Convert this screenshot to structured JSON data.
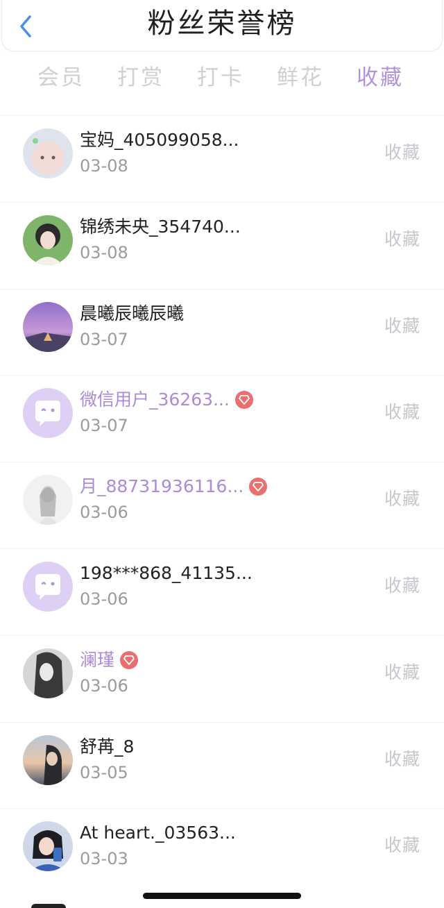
{
  "header": {
    "title": "粉丝荣誉榜",
    "back_icon": "chevron-left-icon",
    "accent_color": "#4a90e2"
  },
  "tabs": [
    {
      "label": "会员",
      "active": false
    },
    {
      "label": "打赏",
      "active": false
    },
    {
      "label": "打卡",
      "active": false
    },
    {
      "label": "鲜花",
      "active": false
    },
    {
      "label": "收藏",
      "active": true
    }
  ],
  "colors": {
    "active_tab": "#b392dc",
    "vip_name": "#ad8ad8",
    "badge": "#ea6e6e"
  },
  "rows": [
    {
      "name": "宝妈_405099058...",
      "date": "03-08",
      "action": "收藏",
      "vip": false
    },
    {
      "name": "锦绣未央_354740...",
      "date": "03-08",
      "action": "收藏",
      "vip": false
    },
    {
      "name": "晨曦辰曦辰曦",
      "date": "03-07",
      "action": "收藏",
      "vip": false
    },
    {
      "name": "微信用户_36263...",
      "date": "03-07",
      "action": "收藏",
      "vip": true
    },
    {
      "name": "月_88731936116...",
      "date": "03-06",
      "action": "收藏",
      "vip": true
    },
    {
      "name": "198***868_41135...",
      "date": "03-06",
      "action": "收藏",
      "vip": false
    },
    {
      "name": "澜瑾",
      "date": "03-06",
      "action": "收藏",
      "vip": true
    },
    {
      "name": "舒苒_8",
      "date": "03-05",
      "action": "收藏",
      "vip": false
    },
    {
      "name": "At heart._03563...",
      "date": "03-03",
      "action": "收藏",
      "vip": false
    }
  ]
}
